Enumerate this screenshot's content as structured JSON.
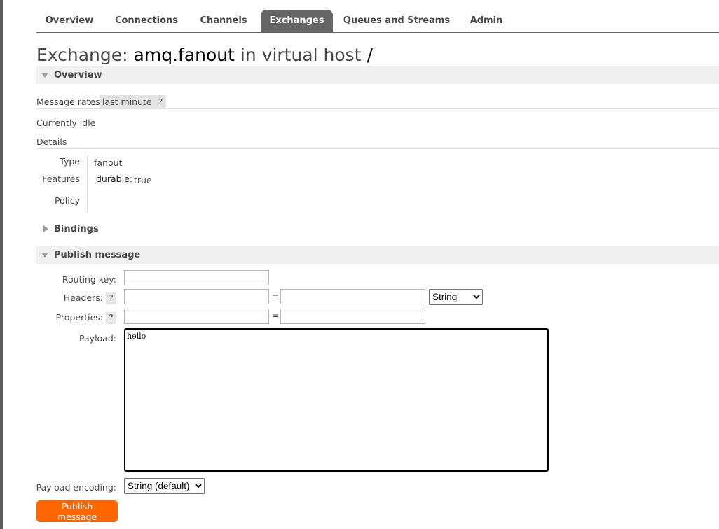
{
  "tabs": [
    {
      "label": "Overview"
    },
    {
      "label": "Connections"
    },
    {
      "label": "Channels"
    },
    {
      "label": "Exchanges",
      "active": true
    },
    {
      "label": "Queues and Streams"
    },
    {
      "label": "Admin"
    }
  ],
  "title": {
    "prefix": "Exchange:",
    "name": "amq.fanout",
    "mid": "in virtual host",
    "vhost": "/"
  },
  "overview": {
    "header": "Overview",
    "rates_label": "Message rates",
    "rates_period": "last minute",
    "help": "?",
    "idle_text": "Currently idle",
    "details_label": "Details",
    "details": {
      "type_key": "Type",
      "type_val": "fanout",
      "features_key": "Features",
      "features_name": "durable:",
      "features_val": "true",
      "policy_key": "Policy"
    }
  },
  "bindings": {
    "header": "Bindings"
  },
  "publish": {
    "header": "Publish message",
    "routing_key_label": "Routing key:",
    "routing_key_value": "",
    "headers_label": "Headers:",
    "headers_help": "?",
    "headers_type": "String",
    "properties_label": "Properties:",
    "properties_help": "?",
    "eq": "=",
    "payload_label": "Payload:",
    "payload_value": "hello",
    "encoding_label": "Payload encoding:",
    "encoding_value": "String (default)",
    "button": "Publish message"
  },
  "colors": {
    "accent": "#ff6600",
    "active_tab": "#666666",
    "section_bg": "#f0f0f0"
  }
}
